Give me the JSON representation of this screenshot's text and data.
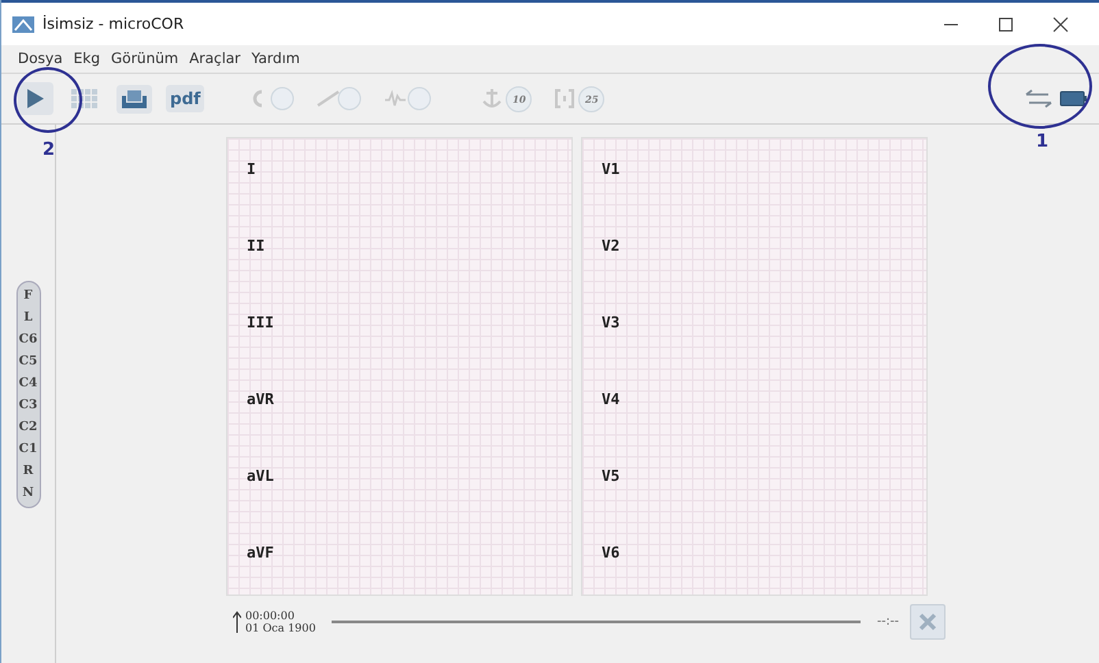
{
  "window": {
    "title": "İsimsiz - microCOR"
  },
  "menu": [
    "Dosya",
    "Ekg",
    "Görünüm",
    "Araçlar",
    "Yardım"
  ],
  "toolbar": [
    {
      "kind": "play",
      "disabled": false
    },
    {
      "kind": "grid",
      "disabled": true
    },
    {
      "kind": "print",
      "disabled": false
    },
    {
      "kind": "pdf",
      "label": "pdf",
      "disabled": false
    },
    {
      "kind": "toggle-c",
      "disabled": true
    },
    {
      "kind": "toggle-ramp",
      "disabled": true
    },
    {
      "kind": "toggle-wave",
      "disabled": true
    },
    {
      "kind": "badge-anchor",
      "label": "10",
      "disabled": true
    },
    {
      "kind": "badge-brackets",
      "label": "25",
      "disabled": true
    }
  ],
  "status_icons": [
    {
      "kind": "connection"
    },
    {
      "kind": "battery"
    }
  ],
  "annotations": [
    {
      "label": "2"
    },
    {
      "label": "1"
    }
  ],
  "electrodes": [
    "F",
    "L",
    "C6",
    "C5",
    "C4",
    "C3",
    "C2",
    "C1",
    "R",
    "N"
  ],
  "panels": [
    {
      "leads": [
        "I",
        "II",
        "III",
        "aVR",
        "aVL",
        "aVF"
      ]
    },
    {
      "leads": [
        "V1",
        "V2",
        "V3",
        "V4",
        "V5",
        "V6"
      ]
    }
  ],
  "timeline": {
    "time": "00:00:00",
    "date": "01 Oca 1900",
    "end": "--:--",
    "close_disabled": true
  }
}
